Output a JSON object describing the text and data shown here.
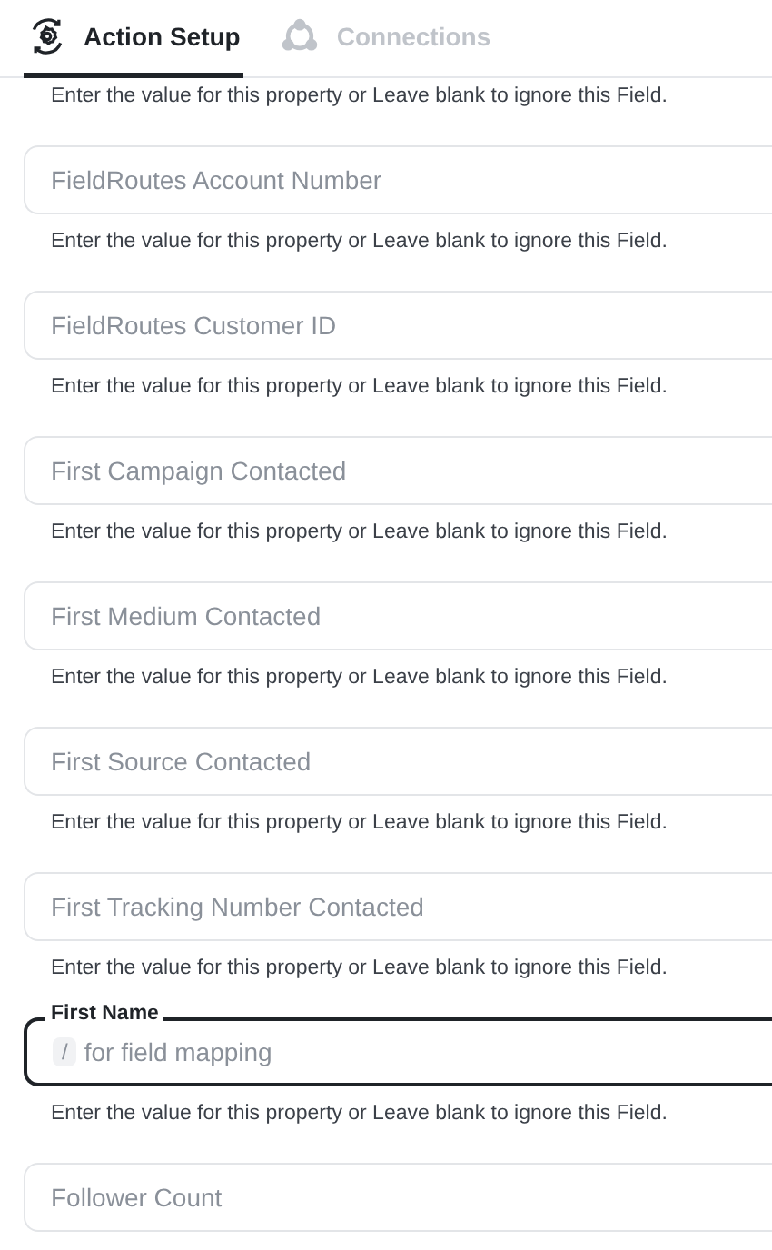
{
  "tabs": [
    {
      "label": "Action Setup",
      "selected": true,
      "kind": "gear"
    },
    {
      "label": "Connections",
      "selected": false,
      "kind": "network"
    }
  ],
  "fields": [
    {
      "kind": "help",
      "text": "Enter the value for this property or Leave blank to ignore this Field."
    },
    {
      "kind": "plain",
      "placeholder": "FieldRoutes Account Number"
    },
    {
      "kind": "help",
      "text": "Enter the value for this property or Leave blank to ignore this Field."
    },
    {
      "kind": "plain",
      "placeholder": "FieldRoutes Customer ID"
    },
    {
      "kind": "help",
      "text": "Enter the value for this property or Leave blank to ignore this Field."
    },
    {
      "kind": "plain",
      "placeholder": "First Campaign Contacted"
    },
    {
      "kind": "help",
      "text": "Enter the value for this property or Leave blank to ignore this Field."
    },
    {
      "kind": "plain",
      "placeholder": "First Medium Contacted"
    },
    {
      "kind": "help",
      "text": "Enter the value for this property or Leave blank to ignore this Field."
    },
    {
      "kind": "plain",
      "placeholder": "First Source Contacted"
    },
    {
      "kind": "help",
      "text": "Enter the value for this property or Leave blank to ignore this Field."
    },
    {
      "kind": "plain",
      "placeholder": "First Tracking Number Contacted"
    },
    {
      "kind": "help",
      "text": "Enter the value for this property or Leave blank to ignore this Field."
    },
    {
      "kind": "focused",
      "label": "First Name",
      "key": "/",
      "placeholder": "for field mapping"
    },
    {
      "kind": "help",
      "text": "Enter the value for this property or Leave blank to ignore this Field."
    },
    {
      "kind": "plain",
      "placeholder": "Follower Count"
    }
  ]
}
